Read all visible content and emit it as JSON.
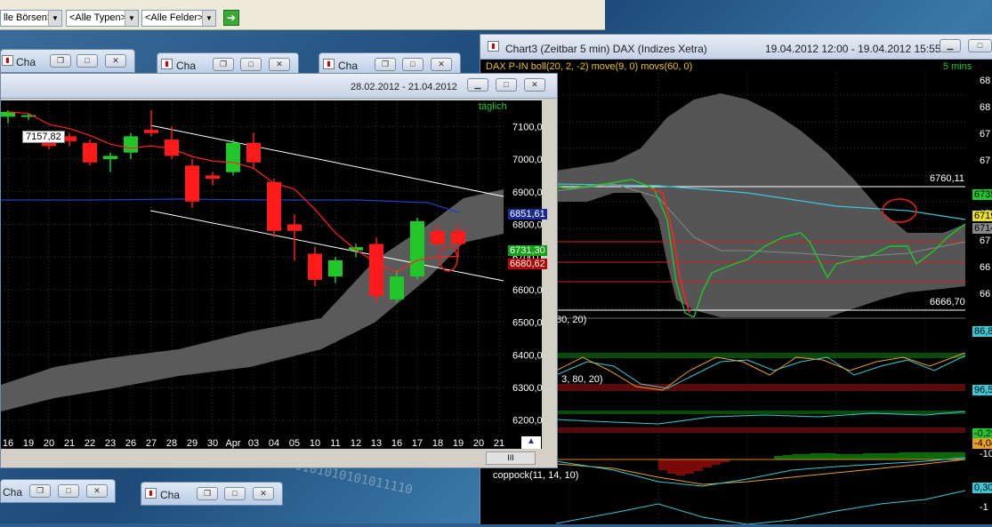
{
  "toolbar": {
    "combo_boerse": "lle Börsen>",
    "combo_typen": "<Alle Typen>",
    "combo_felder": "<Alle Felder>"
  },
  "minimized": [
    {
      "title": "Cha"
    },
    {
      "title": "Cha"
    },
    {
      "title": "Cha"
    },
    {
      "title": "Cha"
    },
    {
      "title": "Cha"
    },
    {
      "title": "Cha"
    }
  ],
  "main_window": {
    "date_range": "28.02.2012 - 21.04.2012",
    "period": "täglich",
    "crosshair_value": "7157,82",
    "y_ticks": [
      "7100,00",
      "7000,00",
      "6900,00",
      "6800,00",
      "6700,00",
      "6600,00",
      "6500,00",
      "6400,00",
      "6300,00",
      "6200,00"
    ],
    "price_labels": {
      "blue": "6851,61",
      "green": "6731,30",
      "red": "6680,62"
    },
    "x_ticks": [
      "16",
      "19",
      "20",
      "21",
      "22",
      "23",
      "26",
      "27",
      "28",
      "29",
      "30",
      "Apr",
      "03",
      "04",
      "05",
      "10",
      "11",
      "12",
      "13",
      "16",
      "17",
      "18",
      "19",
      "20",
      "21"
    ],
    "scroll_label": "III"
  },
  "right_window": {
    "title": "Chart3 (Zeitbar 5 min)  DAX (Indizes Xetra)",
    "range": "19.04.2012 12:00 - 19.04.2012 15:55",
    "legend": "DAX P-IN  boll(20, 2, -2) move(9, 0) movs(60, 0)",
    "interval": "5 mins",
    "level_high": "6760,11",
    "level_low": "6666,70",
    "right_ticks": [
      "68",
      "68",
      "67",
      "67",
      "67",
      "67",
      "66",
      "66"
    ],
    "right_prices": {
      "p1": "6735",
      "p2": "6719",
      "p3": "6714"
    },
    "osc1_label": "80, 20)",
    "osc1_value": "86,8",
    "osc2_label": ", 3, 80, 20)",
    "osc2_value": "96,5",
    "osc3_values": [
      "-0,29",
      "-4,04",
      "-10"
    ],
    "coppock_label": "coppock(11, 14, 10)",
    "coppock_values": [
      "0,30",
      "-1"
    ]
  },
  "colors": {
    "bull": "#21c72a",
    "bear": "#ff1a1a",
    "band": "#5a5a5a",
    "grid": "#3a3a3a"
  },
  "chart_data": {
    "type": "candlestick",
    "x_start": "16",
    "ylim": [
      6150,
      7180
    ],
    "candles": [
      {
        "o": 7130,
        "h": 7150,
        "l": 7110,
        "c": 7145
      },
      {
        "o": 7130,
        "h": 7140,
        "l": 7120,
        "c": 7135
      },
      {
        "o": 7060,
        "h": 7070,
        "l": 7030,
        "c": 7040
      },
      {
        "o": 7070,
        "h": 7080,
        "l": 7040,
        "c": 7055
      },
      {
        "o": 7050,
        "h": 7060,
        "l": 6980,
        "c": 6990
      },
      {
        "o": 7000,
        "h": 7020,
        "l": 6960,
        "c": 7010
      },
      {
        "o": 7020,
        "h": 7080,
        "l": 7000,
        "c": 7070
      },
      {
        "o": 7090,
        "h": 7150,
        "l": 7070,
        "c": 7080
      },
      {
        "o": 7060,
        "h": 7100,
        "l": 7000,
        "c": 7010
      },
      {
        "o": 6980,
        "h": 7000,
        "l": 6850,
        "c": 6870
      },
      {
        "o": 6950,
        "h": 6960,
        "l": 6920,
        "c": 6940
      },
      {
        "o": 6960,
        "h": 7060,
        "l": 6950,
        "c": 7050
      },
      {
        "o": 7050,
        "h": 7080,
        "l": 6970,
        "c": 6990
      },
      {
        "o": 6930,
        "h": 6940,
        "l": 6760,
        "c": 6780
      },
      {
        "o": 6800,
        "h": 6830,
        "l": 6690,
        "c": 6780
      },
      {
        "o": 6710,
        "h": 6730,
        "l": 6610,
        "c": 6630
      },
      {
        "o": 6640,
        "h": 6700,
        "l": 6620,
        "c": 6690
      },
      {
        "o": 6720,
        "h": 6740,
        "l": 6700,
        "c": 6730
      },
      {
        "o": 6740,
        "h": 6760,
        "l": 6560,
        "c": 6580
      },
      {
        "o": 6570,
        "h": 6660,
        "l": 6560,
        "c": 6640
      },
      {
        "o": 6640,
        "h": 6820,
        "l": 6630,
        "c": 6810
      },
      {
        "o": 6780,
        "h": 6800,
        "l": 6730,
        "c": 6740
      },
      {
        "o": 6780,
        "h": 6800,
        "l": 6700,
        "c": 6740
      }
    ]
  }
}
